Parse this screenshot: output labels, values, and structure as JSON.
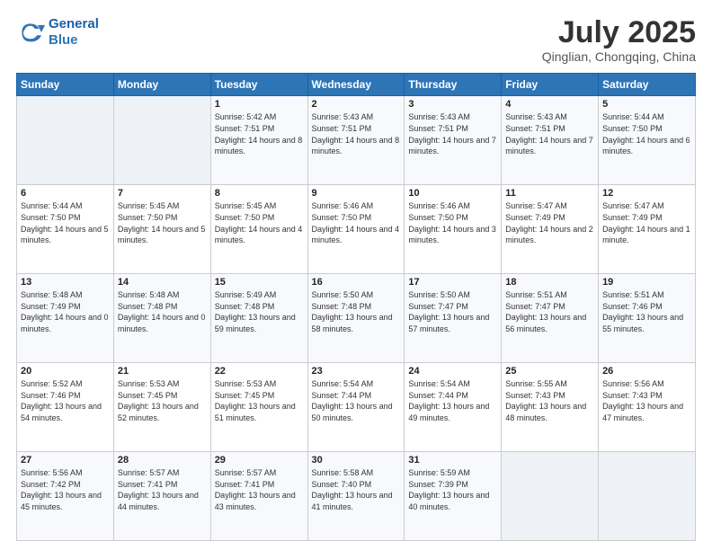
{
  "header": {
    "logo_line1": "General",
    "logo_line2": "Blue",
    "month": "July 2025",
    "location": "Qinglian, Chongqing, China"
  },
  "weekdays": [
    "Sunday",
    "Monday",
    "Tuesday",
    "Wednesday",
    "Thursday",
    "Friday",
    "Saturday"
  ],
  "weeks": [
    [
      {
        "day": "",
        "info": ""
      },
      {
        "day": "",
        "info": ""
      },
      {
        "day": "1",
        "info": "Sunrise: 5:42 AM\nSunset: 7:51 PM\nDaylight: 14 hours and 8 minutes."
      },
      {
        "day": "2",
        "info": "Sunrise: 5:43 AM\nSunset: 7:51 PM\nDaylight: 14 hours and 8 minutes."
      },
      {
        "day": "3",
        "info": "Sunrise: 5:43 AM\nSunset: 7:51 PM\nDaylight: 14 hours and 7 minutes."
      },
      {
        "day": "4",
        "info": "Sunrise: 5:43 AM\nSunset: 7:51 PM\nDaylight: 14 hours and 7 minutes."
      },
      {
        "day": "5",
        "info": "Sunrise: 5:44 AM\nSunset: 7:50 PM\nDaylight: 14 hours and 6 minutes."
      }
    ],
    [
      {
        "day": "6",
        "info": "Sunrise: 5:44 AM\nSunset: 7:50 PM\nDaylight: 14 hours and 5 minutes."
      },
      {
        "day": "7",
        "info": "Sunrise: 5:45 AM\nSunset: 7:50 PM\nDaylight: 14 hours and 5 minutes."
      },
      {
        "day": "8",
        "info": "Sunrise: 5:45 AM\nSunset: 7:50 PM\nDaylight: 14 hours and 4 minutes."
      },
      {
        "day": "9",
        "info": "Sunrise: 5:46 AM\nSunset: 7:50 PM\nDaylight: 14 hours and 4 minutes."
      },
      {
        "day": "10",
        "info": "Sunrise: 5:46 AM\nSunset: 7:50 PM\nDaylight: 14 hours and 3 minutes."
      },
      {
        "day": "11",
        "info": "Sunrise: 5:47 AM\nSunset: 7:49 PM\nDaylight: 14 hours and 2 minutes."
      },
      {
        "day": "12",
        "info": "Sunrise: 5:47 AM\nSunset: 7:49 PM\nDaylight: 14 hours and 1 minute."
      }
    ],
    [
      {
        "day": "13",
        "info": "Sunrise: 5:48 AM\nSunset: 7:49 PM\nDaylight: 14 hours and 0 minutes."
      },
      {
        "day": "14",
        "info": "Sunrise: 5:48 AM\nSunset: 7:48 PM\nDaylight: 14 hours and 0 minutes."
      },
      {
        "day": "15",
        "info": "Sunrise: 5:49 AM\nSunset: 7:48 PM\nDaylight: 13 hours and 59 minutes."
      },
      {
        "day": "16",
        "info": "Sunrise: 5:50 AM\nSunset: 7:48 PM\nDaylight: 13 hours and 58 minutes."
      },
      {
        "day": "17",
        "info": "Sunrise: 5:50 AM\nSunset: 7:47 PM\nDaylight: 13 hours and 57 minutes."
      },
      {
        "day": "18",
        "info": "Sunrise: 5:51 AM\nSunset: 7:47 PM\nDaylight: 13 hours and 56 minutes."
      },
      {
        "day": "19",
        "info": "Sunrise: 5:51 AM\nSunset: 7:46 PM\nDaylight: 13 hours and 55 minutes."
      }
    ],
    [
      {
        "day": "20",
        "info": "Sunrise: 5:52 AM\nSunset: 7:46 PM\nDaylight: 13 hours and 54 minutes."
      },
      {
        "day": "21",
        "info": "Sunrise: 5:53 AM\nSunset: 7:45 PM\nDaylight: 13 hours and 52 minutes."
      },
      {
        "day": "22",
        "info": "Sunrise: 5:53 AM\nSunset: 7:45 PM\nDaylight: 13 hours and 51 minutes."
      },
      {
        "day": "23",
        "info": "Sunrise: 5:54 AM\nSunset: 7:44 PM\nDaylight: 13 hours and 50 minutes."
      },
      {
        "day": "24",
        "info": "Sunrise: 5:54 AM\nSunset: 7:44 PM\nDaylight: 13 hours and 49 minutes."
      },
      {
        "day": "25",
        "info": "Sunrise: 5:55 AM\nSunset: 7:43 PM\nDaylight: 13 hours and 48 minutes."
      },
      {
        "day": "26",
        "info": "Sunrise: 5:56 AM\nSunset: 7:43 PM\nDaylight: 13 hours and 47 minutes."
      }
    ],
    [
      {
        "day": "27",
        "info": "Sunrise: 5:56 AM\nSunset: 7:42 PM\nDaylight: 13 hours and 45 minutes."
      },
      {
        "day": "28",
        "info": "Sunrise: 5:57 AM\nSunset: 7:41 PM\nDaylight: 13 hours and 44 minutes."
      },
      {
        "day": "29",
        "info": "Sunrise: 5:57 AM\nSunset: 7:41 PM\nDaylight: 13 hours and 43 minutes."
      },
      {
        "day": "30",
        "info": "Sunrise: 5:58 AM\nSunset: 7:40 PM\nDaylight: 13 hours and 41 minutes."
      },
      {
        "day": "31",
        "info": "Sunrise: 5:59 AM\nSunset: 7:39 PM\nDaylight: 13 hours and 40 minutes."
      },
      {
        "day": "",
        "info": ""
      },
      {
        "day": "",
        "info": ""
      }
    ]
  ]
}
